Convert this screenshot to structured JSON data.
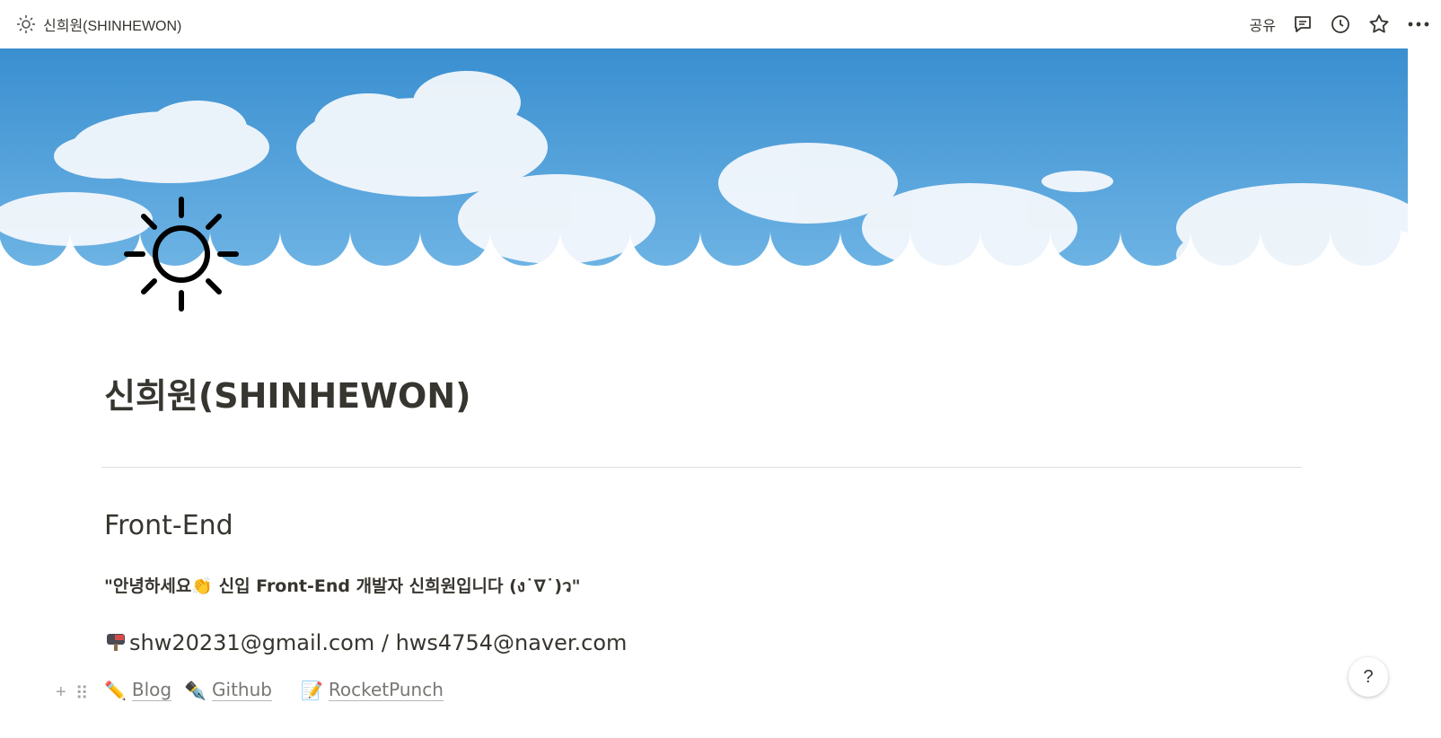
{
  "topbar": {
    "breadcrumb": "신희원(SHINHEWON)",
    "share_label": "공유"
  },
  "page": {
    "title": "신희원(SHINHEWON)",
    "heading": "Front-End",
    "intro_before": "\"안녕하세요",
    "intro_after": " 신입 Front-End 개발자 신희원입니다 (ง˙∇˙)ว\"",
    "email": "shw20231@gmail.com / hws4754@naver.com",
    "links": [
      {
        "label": "Blog"
      },
      {
        "label": "Github"
      },
      {
        "label": "RocketPunch"
      }
    ]
  },
  "help_label": "?",
  "colors": {
    "text": "#37352f",
    "muted": "#787774",
    "sky_top": "#3a8fd0",
    "sky_bottom": "#6db3e4"
  }
}
